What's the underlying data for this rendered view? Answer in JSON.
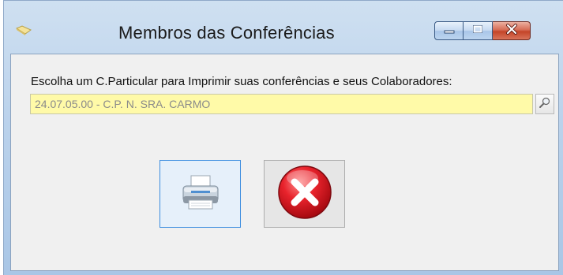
{
  "window": {
    "title": "Membros das Conferências",
    "app_icon": "folder-tag-icon",
    "caption_buttons": {
      "minimize_icon": "minimize-icon",
      "maximize_icon": "maximize-icon",
      "close_icon": "close-icon",
      "close_color": "#c44428"
    }
  },
  "form": {
    "prompt_label": "Escolha um C.Particular para Imprimir suas conferências e seus Colaboradores:",
    "conference_field": {
      "value": "24.07.05.00 - C.P. N. SRA. CARMO",
      "background": "#fffaa8"
    },
    "lookup_icon": "magnifier-icon"
  },
  "actions": {
    "print_icon": "printer-icon",
    "cancel_icon": "cancel-icon",
    "focus_color": "#3d8ee0",
    "cancel_color": "#e8232c"
  }
}
